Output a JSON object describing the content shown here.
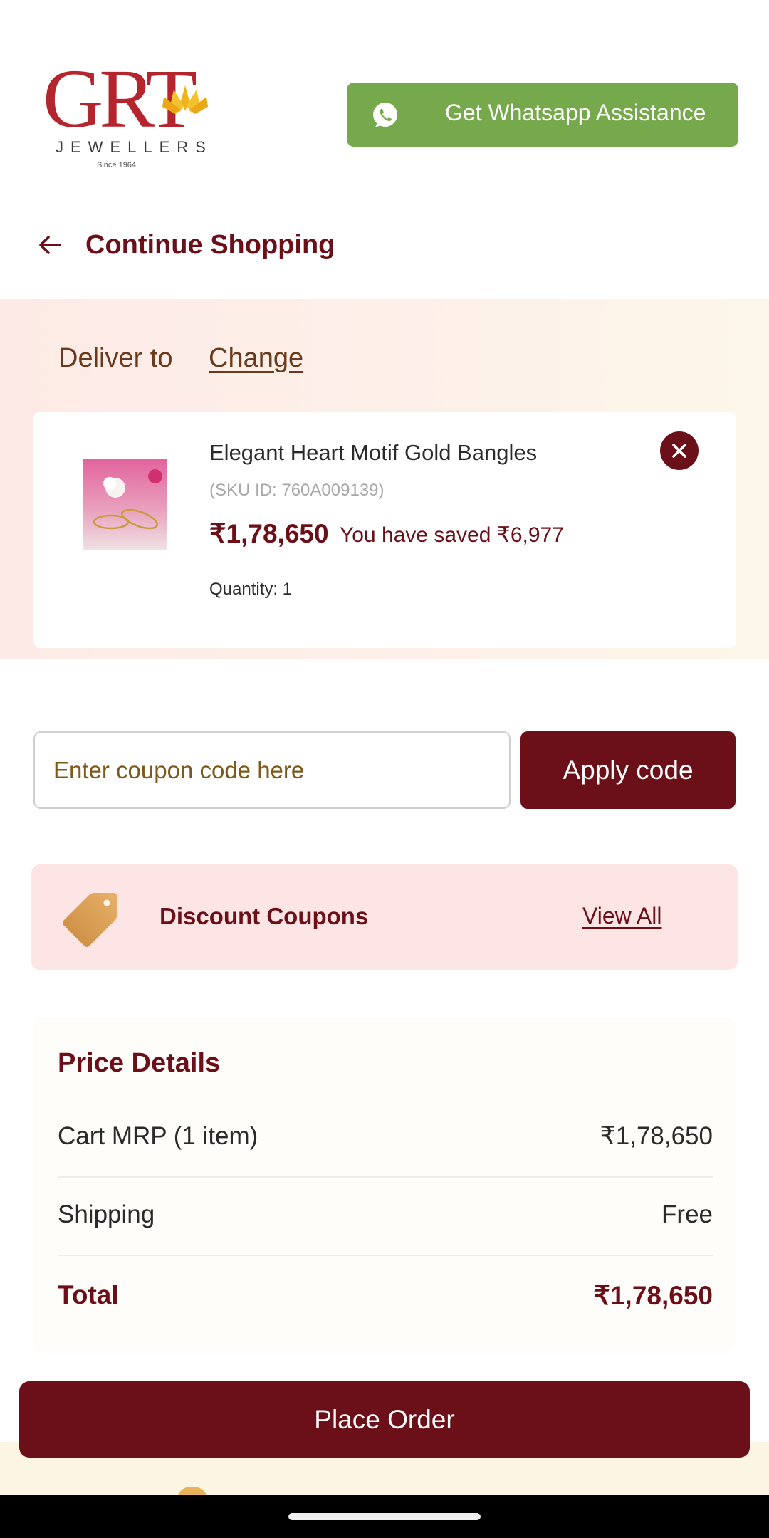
{
  "header": {
    "logo_text": "GRT",
    "logo_sub": "JEWELLERS",
    "logo_since": "Since 1964",
    "whatsapp_label": "Get Whatsapp Assistance"
  },
  "nav": {
    "continue_label": "Continue Shopping"
  },
  "delivery": {
    "label": "Deliver to",
    "change_label": "Change"
  },
  "cart_item": {
    "name": "Elegant Heart Motif Gold Bangles",
    "sku": "(SKU ID: 760A009139)",
    "price": "₹1,78,650",
    "saved": "You have saved ₹6,977",
    "quantity": "Quantity: 1"
  },
  "coupon": {
    "placeholder": "Enter coupon code here",
    "apply_label": "Apply code"
  },
  "discount": {
    "label": "Discount Coupons",
    "view_all": "View All"
  },
  "price_details": {
    "title": "Price Details",
    "rows": [
      {
        "label": "Cart MRP (1  item)",
        "value": "₹1,78,650"
      },
      {
        "label": "Shipping",
        "value": "Free"
      },
      {
        "label": "Total",
        "value": "₹1,78,650"
      }
    ]
  },
  "actions": {
    "place_order": "Place Order"
  },
  "colors": {
    "brand": "#6b1019",
    "whatsapp_green": "#76a84c",
    "discount_bg": "#fde5e6"
  },
  "icons": [
    "whatsapp-icon",
    "back-arrow-icon",
    "close-icon",
    "tag-icon"
  ]
}
